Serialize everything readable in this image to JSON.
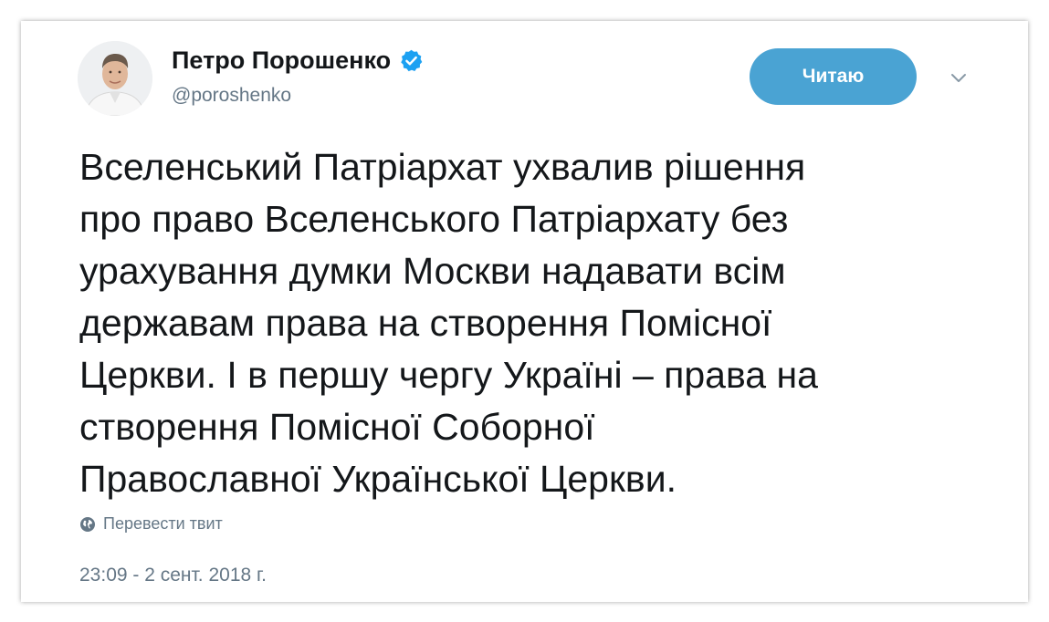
{
  "author": {
    "display_name": "Петро Порошенко",
    "handle": "@poroshenko",
    "verified_icon": "verified-badge-icon",
    "avatar_icon": "profile-photo"
  },
  "actions": {
    "follow_label": "Читаю",
    "menu_icon": "chevron-down-icon"
  },
  "tweet": {
    "text": "Вселенський Патріархат ухвалив рішення\nпро право Вселенського Патріархату без\nурахування думки Москви надавати всім\nдержавам права на створення Помісної\nЦеркви. І в першу чергу Україні – права на\nстворення Помісної Соборної\nПравославної Української Церкви.",
    "translate_label": "Перевести твит",
    "translate_icon": "globe-icon",
    "timestamp": "23:09 - 2 сент. 2018 г."
  },
  "colors": {
    "accent": "#4aa3d3",
    "verified": "#1da1f2",
    "text": "#14171a",
    "muted": "#657786"
  }
}
